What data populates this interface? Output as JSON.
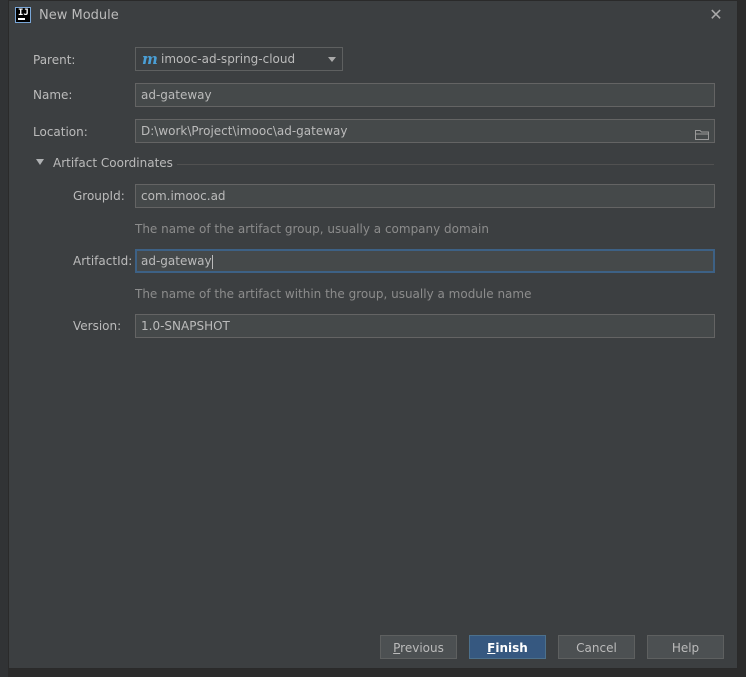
{
  "dialog": {
    "title": "New Module"
  },
  "form": {
    "parent_label": "Parent:",
    "parent_value": "imooc-ad-spring-cloud",
    "name_label": "Name:",
    "name_value": "ad-gateway",
    "location_label": "Location:",
    "location_value": "D:\\work\\Project\\imooc\\ad-gateway"
  },
  "artifact": {
    "section_title": "Artifact Coordinates",
    "groupid_label": "GroupId:",
    "groupid_value": "com.imooc.ad",
    "groupid_hint": "The name of the artifact group, usually a company domain",
    "artifactid_label": "ArtifactId:",
    "artifactid_value": "ad-gateway",
    "artifactid_hint": "The name of the artifact within the group, usually a module name",
    "version_label": "Version:",
    "version_value": "1.0-SNAPSHOT"
  },
  "buttons": {
    "previous_mnemonic": "P",
    "previous_rest": "revious",
    "finish_mnemonic": "F",
    "finish_rest": "inish",
    "cancel": "Cancel",
    "help": "Help"
  },
  "colors": {
    "dialog_bg": "#3c3f41",
    "field_bg": "#45494a",
    "focus_border": "#3d6185",
    "default_button_bg": "#365880",
    "maven_icon": "#4a9fd6"
  },
  "icons": {
    "app": "intellij-idea-icon",
    "close": "close-icon",
    "parent_module": "maven-icon",
    "dropdown": "chevron-down-icon",
    "browse": "folder-icon",
    "section_toggle": "triangle-down-icon"
  }
}
